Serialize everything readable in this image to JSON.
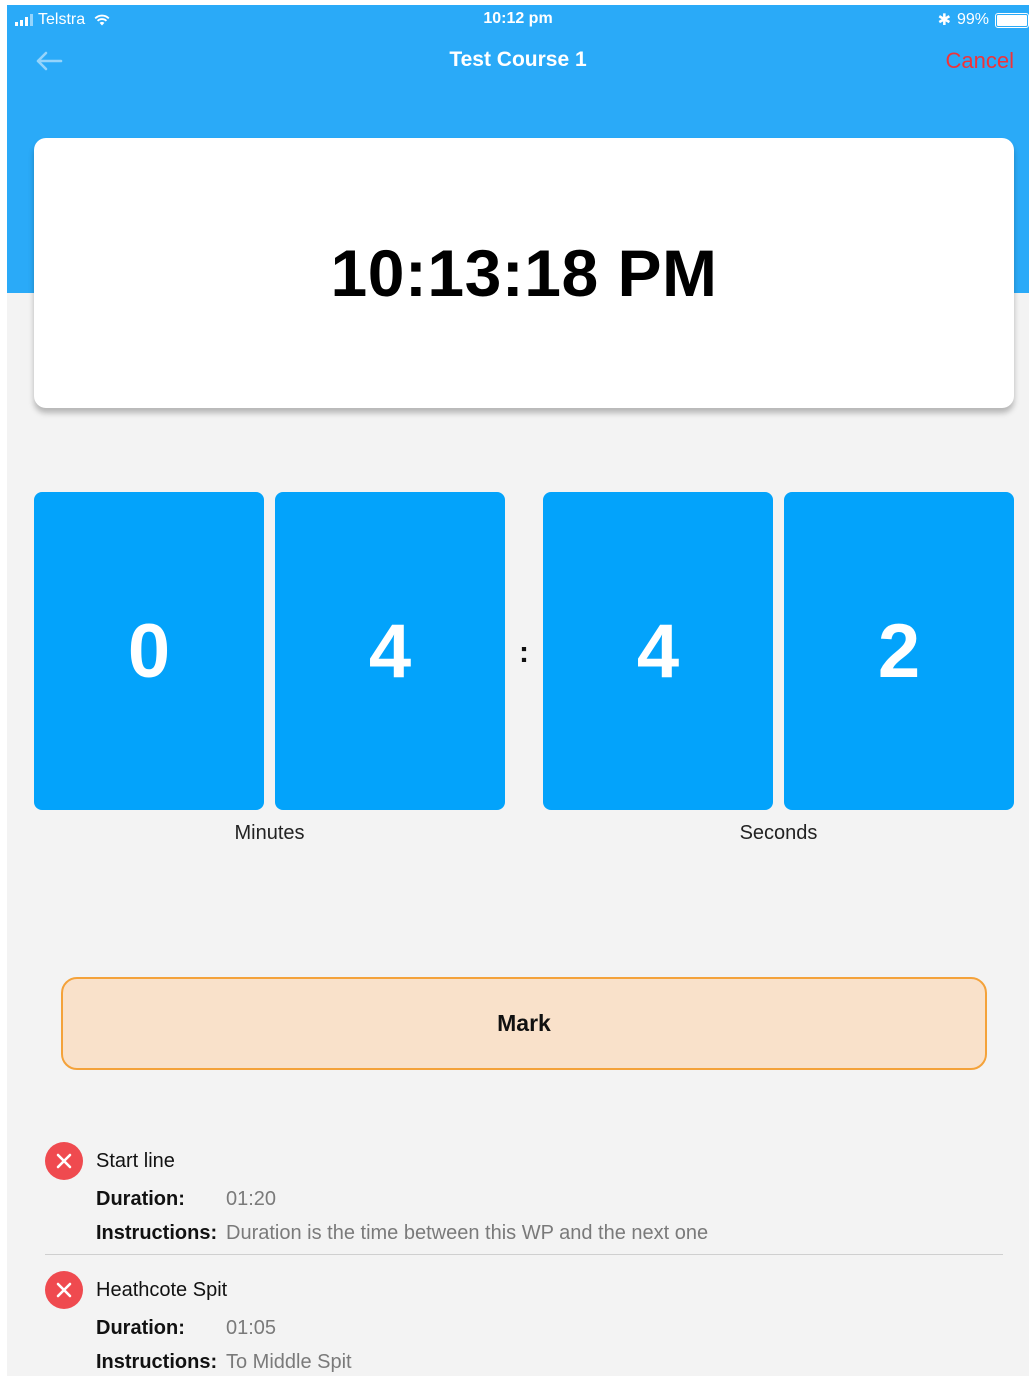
{
  "status_bar": {
    "carrier": "Telstra",
    "time": "10:12 pm",
    "bluetooth": "✱",
    "battery_percent": "99%",
    "battery_level": 0.99
  },
  "nav": {
    "title": "Test Course 1",
    "cancel_label": "Cancel",
    "back_icon": "arrow-left-icon"
  },
  "clock": {
    "time": "10:13:18 PM"
  },
  "countdown": {
    "minutes_digits": [
      "0",
      "4"
    ],
    "seconds_digits": [
      "4",
      "2"
    ],
    "separator": ":",
    "minutes_label": "Minutes",
    "seconds_label": "Seconds"
  },
  "mark_label": "Mark",
  "waypoints": [
    {
      "name": "Start line",
      "duration_label": "Duration:",
      "duration": "01:20",
      "instructions_label": "Instructions:",
      "instructions": "Duration is the time between this WP and the next one"
    },
    {
      "name": "Heathcote Spit",
      "duration_label": "Duration:",
      "duration": "01:05",
      "instructions_label": "Instructions:",
      "instructions": "To Middle Spit"
    }
  ],
  "colors": {
    "header": "#2aaaf8",
    "digit_tile": "#03a3fb",
    "cancel": "#f0333a",
    "mark_fill": "#f9e1ca",
    "mark_border": "#f4a23a",
    "remove": "#ef4a4f"
  }
}
